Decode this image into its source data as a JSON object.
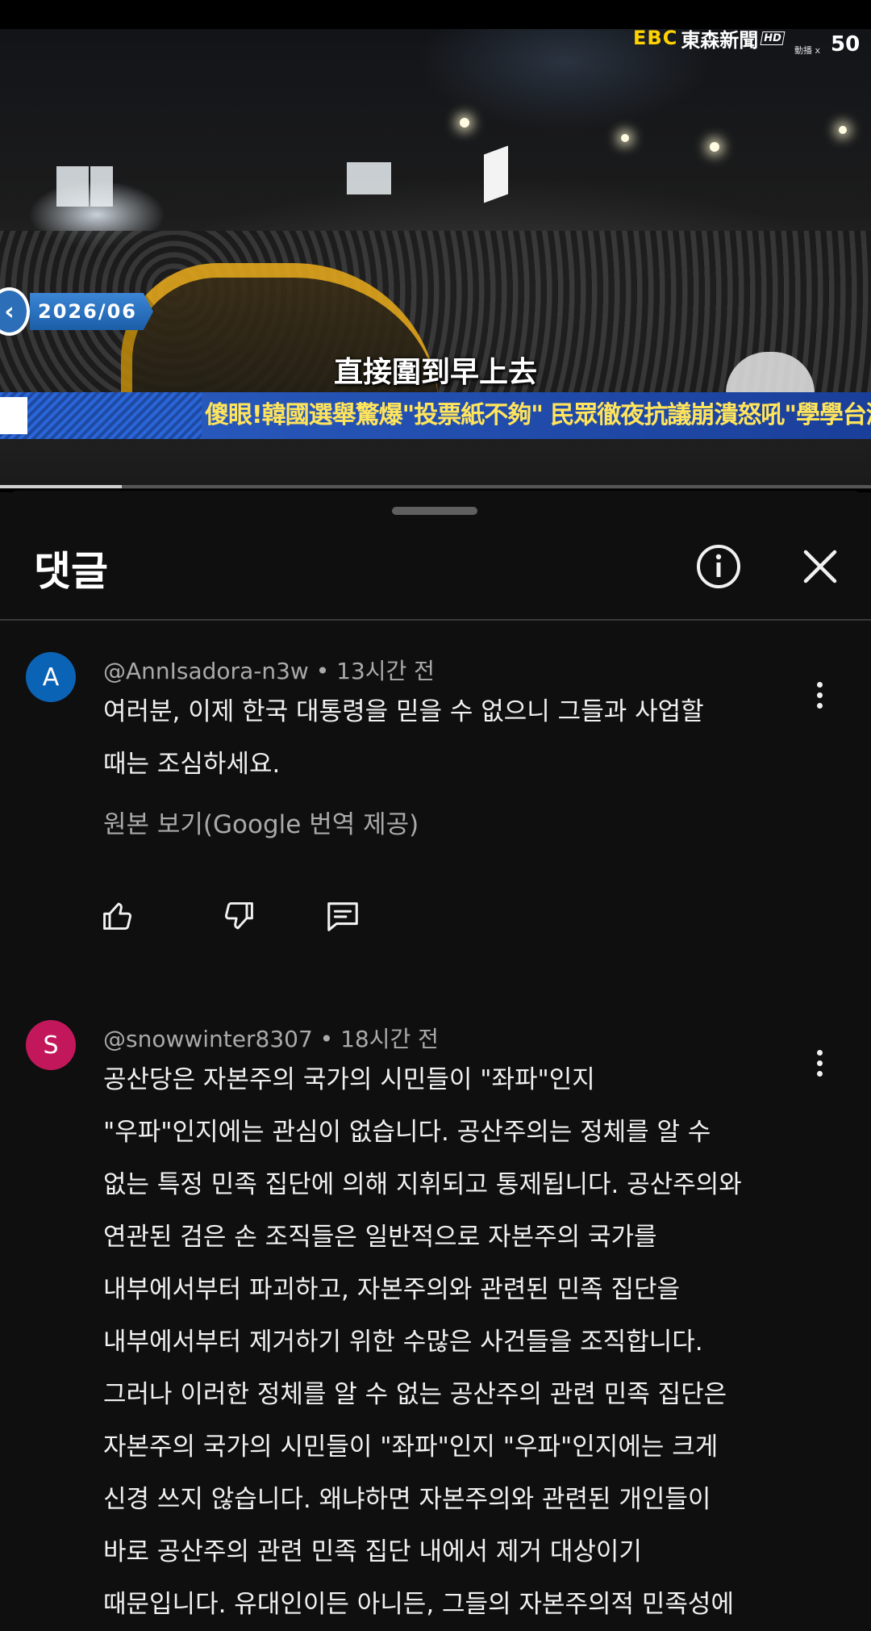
{
  "video": {
    "channel_logo": "EBC",
    "channel_name": "東森新聞",
    "channel_hd": "HD",
    "channel_sub": "動播 x",
    "channel_num": "50",
    "date_badge": "2026/06",
    "subtitle": "直接圍到早上去",
    "headline": "傻眼!韓國選舉驚爆\"投票紙不夠\" 民眾徹夜抗議崩潰怒吼\"學學台灣\"!",
    "progress_fraction": 0.14
  },
  "sheet": {
    "title": "댓글"
  },
  "comments": [
    {
      "avatar_letter": "A",
      "avatar_color": "#0b63b6",
      "author": "@AnnIsadora-n3w",
      "time": "13시간 전",
      "text": "여러분, 이제 한국 대통령을 믿을 수 없으니 그들과 사업할\n때는 조심하세요.",
      "translate_label": "원본 보기(Google 번역 제공)"
    },
    {
      "avatar_letter": "S",
      "avatar_color": "#c2185b",
      "author": "@snowwinter8307",
      "time": "18시간 전",
      "text": "공산당은 자본주의 국가의 시민들이 \"좌파\"인지\n\"우파\"인지에는 관심이 없습니다. 공산주의는 정체를 알 수\n없는 특정 민족 집단에 의해 지휘되고 통제됩니다. 공산주의와\n연관된 검은 손 조직들은 일반적으로 자본주의 국가를\n내부에서부터 파괴하고, 자본주의와 관련된 민족 집단을\n내부에서부터 제거하기 위한 수많은 사건들을 조직합니다.\n그러나 이러한 정체를 알 수 없는 공산주의 관련 민족 집단은\n자본주의 국가의 시민들이 \"좌파\"인지 \"우파\"인지에는 크게\n신경 쓰지 않습니다. 왜냐하면 자본주의와 관련된 개인들이\n바로 공산주의 관련 민족 집단 내에서 제거 대상이기\n때문입니다. 유대인이든 아니든, 그들의 자본주의적 민족성에"
    }
  ],
  "icons": {
    "info": "info-icon",
    "close": "close-icon",
    "more": "more-vert-icon",
    "like": "thumb-up-icon",
    "dislike": "thumb-down-icon",
    "reply": "reply-icon"
  }
}
